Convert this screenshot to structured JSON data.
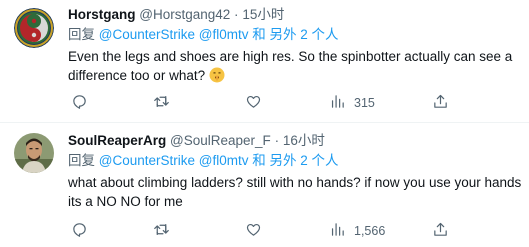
{
  "tweets": [
    {
      "display_name": "Horstgang",
      "handle": "@Horstgang42",
      "separator": "·",
      "time": "15小时",
      "reply_prefix": "回复",
      "reply_mentions": "@CounterStrike @fl0mtv",
      "reply_suffix": "和 另外 2 个人",
      "text": "Even the legs and shoes are high res. So the spinbotter actually can see a difference too or what?",
      "emoji": "shushing-face",
      "views": "315"
    },
    {
      "display_name": "SoulReaperArg",
      "handle": "@SoulReaper_F",
      "separator": "·",
      "time": "16小时",
      "reply_prefix": "回复",
      "reply_mentions": "@CounterStrike @fl0mtv",
      "reply_suffix": "和 另外 2 个人",
      "text": "what about climbing ladders? still with no hands? if now you use your hands its a NO NO for me",
      "views": "1,566"
    }
  ],
  "icons": [
    "reply-icon",
    "retweet-icon",
    "like-icon",
    "views-icon",
    "share-icon"
  ],
  "colors": {
    "link": "#1d9bf0",
    "secondary_text": "#536471",
    "primary_text": "#0f1419",
    "divider": "#eff3f4"
  }
}
